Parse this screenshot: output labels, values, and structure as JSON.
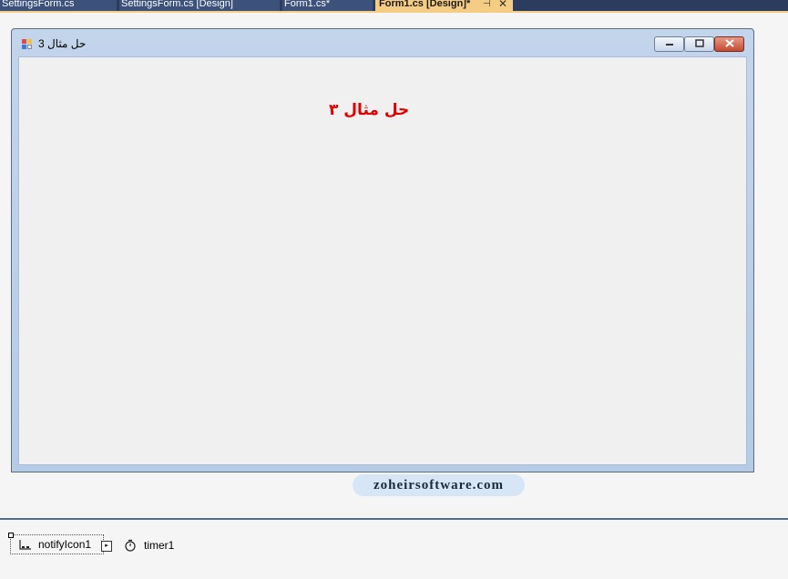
{
  "tabs": [
    {
      "label": "SettingsForm.cs"
    },
    {
      "label": "SettingsForm.cs [Design]"
    },
    {
      "label": "Form1.cs*"
    },
    {
      "label": "Form1.cs [Design]*",
      "active": true
    }
  ],
  "tab_icons": {
    "pin": "pin-icon",
    "close": "close-icon"
  },
  "form": {
    "title": "حل مثال 3",
    "label_text": "حل مثال ۳",
    "label_color": "#e00000",
    "buttons": {
      "minimize": "minimize-icon",
      "maximize": "maximize-icon",
      "close": "close-icon"
    }
  },
  "watermark": "zoheirsoftware.com",
  "tray": {
    "components": [
      {
        "name": "notifyIcon1",
        "icon": "notify-icon",
        "selected": true
      },
      {
        "name": "timer1",
        "icon": "stopwatch-icon"
      }
    ]
  },
  "colors": {
    "tab_active": "#f5cc84",
    "tab_strip": "#2b3c5f",
    "window_frame": "#c3d5eb",
    "client_area": "#f0f0f0"
  }
}
